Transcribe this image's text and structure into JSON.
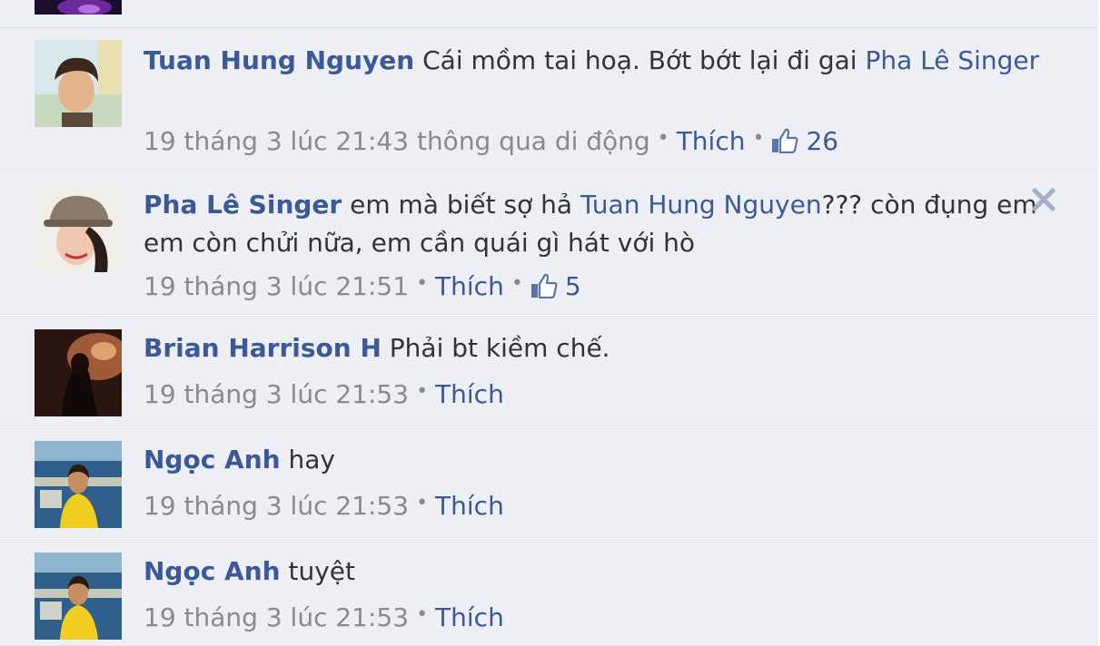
{
  "comments": [
    {
      "author": "Tuan Hung Nguyen",
      "text_before": " Cái mồm tai hoạ. Bớt bớt lại đi gai ",
      "mention": "Pha Lê Singer",
      "text_after": "",
      "timestamp": "19 tháng 3 lúc 21:43 thông qua di động",
      "like_label": "Thích",
      "like_count": "26"
    },
    {
      "author": "Pha Lê Singer",
      "text_before": " em mà biết sợ hả ",
      "mention": "Tuan Hung Nguyen",
      "text_after": "??? còn đụng em em còn chửi nữa, em cần quái gì hát với hò",
      "timestamp": "19 tháng 3 lúc 21:51",
      "like_label": "Thích",
      "like_count": "5"
    },
    {
      "author": "Brian Harrison H",
      "text_before": " Phải bt kiềm chế.",
      "timestamp": "19 tháng 3 lúc 21:53",
      "like_label": "Thích"
    },
    {
      "author": "Ngọc Anh",
      "text_before": " hay",
      "timestamp": "19 tháng 3 lúc 21:53",
      "like_label": "Thích"
    },
    {
      "author": "Ngọc Anh",
      "text_before": " tuyệt",
      "timestamp": "19 tháng 3 lúc 21:53",
      "like_label": "Thích"
    }
  ],
  "icons": {
    "like": "thumbs-up-icon",
    "remove": "close-icon"
  },
  "colors": {
    "link": "#3b5998",
    "background": "#edeff4",
    "meta_text": "#8a8a8a"
  }
}
